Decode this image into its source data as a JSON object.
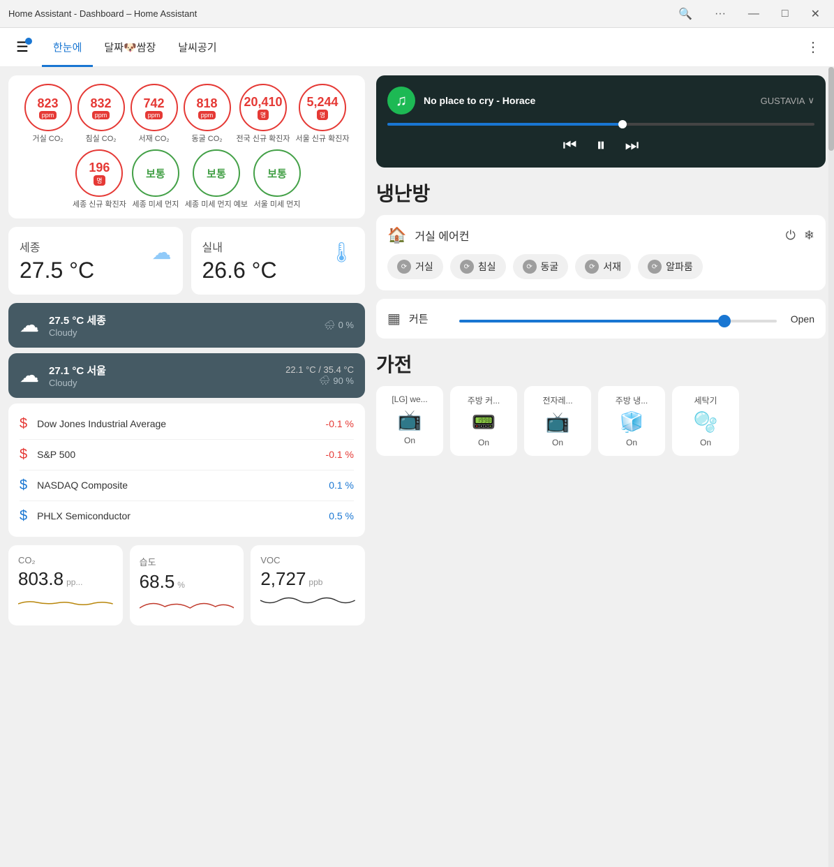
{
  "titlebar": {
    "title": "Home Assistant - Dashboard – Home Assistant",
    "btn_search": "🔍",
    "btn_more": "···",
    "btn_min": "—",
    "btn_max": "□",
    "btn_close": "✕"
  },
  "navbar": {
    "tab1": "한눈에",
    "tab2": "달짜🐶쌈장",
    "tab3": "날씨공기",
    "more_icon": "⋮"
  },
  "aq": {
    "items": [
      {
        "value": "823",
        "unit": "ppm",
        "label": "거실 CO₂",
        "type": "red"
      },
      {
        "value": "832",
        "unit": "ppm",
        "label": "침실 CO₂",
        "type": "red"
      },
      {
        "value": "742",
        "unit": "ppm",
        "label": "서재 CO₂",
        "type": "red"
      },
      {
        "value": "818",
        "unit": "ppm",
        "label": "동굴 CO₂",
        "type": "red"
      },
      {
        "value": "20,410",
        "unit": "명",
        "label": "전국 신규\n확진자",
        "type": "red"
      },
      {
        "value": "5,244",
        "unit": "명",
        "label": "서울 신규\n확진자",
        "type": "red"
      },
      {
        "value": "196",
        "unit": "명",
        "label": "세종 신규\n확진자",
        "type": "red"
      },
      {
        "value": "보통",
        "unit": "",
        "label": "세종 미세\n먼지",
        "type": "green"
      },
      {
        "value": "보통",
        "unit": "",
        "label": "세종 미세\n먼지 예보",
        "type": "green"
      },
      {
        "value": "보통",
        "unit": "",
        "label": "서울 미세\n먼지",
        "type": "green"
      }
    ]
  },
  "weather": {
    "sejong_title": "세종",
    "sejong_temp": "27.5 °C",
    "indoor_title": "실내",
    "indoor_temp": "26.6 °C",
    "forecast": [
      {
        "temp": "27.5 °C 세종",
        "desc": "Cloudy",
        "rain": "0 %"
      },
      {
        "temp": "27.1 °C 서울",
        "desc": "Cloudy",
        "temp2": "22.1 °C / 35.4 °C",
        "rain": "90 %"
      }
    ]
  },
  "stocks": [
    {
      "name": "Dow Jones Industrial Average",
      "change": "-0.1 %",
      "trend": "neg"
    },
    {
      "name": "S&P 500",
      "change": "-0.1 %",
      "trend": "neg"
    },
    {
      "name": "NASDAQ Composite",
      "change": "0.1 %",
      "trend": "pos"
    },
    {
      "name": "PHLX Semiconductor",
      "change": "0.5 %",
      "trend": "pos"
    }
  ],
  "sensors": [
    {
      "label": "CO₂",
      "value": "803.8",
      "unit": "pp..."
    },
    {
      "label": "습도",
      "value": "68.5",
      "unit": "%"
    },
    {
      "label": "VOC",
      "value": "2,727",
      "unit": "ppb"
    }
  ],
  "spotify": {
    "song": "No place to cry - Horace",
    "device": "GUSTAVIA",
    "progress_pct": 55
  },
  "hvac": {
    "section_title": "냉난방",
    "name": "거실 에어컨",
    "rooms": [
      "거실",
      "침실",
      "동굴",
      "서재",
      "알파룸"
    ]
  },
  "curtain": {
    "name": "커튼",
    "value": 85,
    "status": "Open"
  },
  "appliances": {
    "section_title": "가전",
    "items": [
      {
        "name": "[LG] we...",
        "status": "On"
      },
      {
        "name": "주방 커...",
        "status": "On"
      },
      {
        "name": "전자레...",
        "status": "On"
      },
      {
        "name": "주방 냉...",
        "status": "On"
      },
      {
        "name": "세탁기",
        "status": "On"
      }
    ]
  }
}
